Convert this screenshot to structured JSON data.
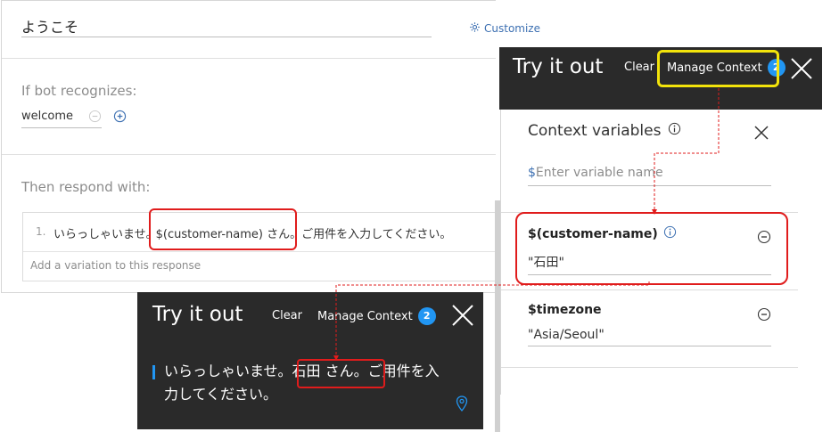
{
  "editor": {
    "node_title": "ようこそ",
    "customize_label": "Customize",
    "recognizes_label": "If bot recognizes:",
    "condition_value": "welcome",
    "respond_label": "Then respond with:",
    "response_number": "1.",
    "response_text_pre": "いらっしゃいませ。",
    "response_text_var": "$(customer-name) さん。",
    "response_text_post": "ご用件を入力してください。",
    "add_variation": "Add a variation to this response"
  },
  "try_it_out_right": {
    "title": "Try it out",
    "clear_label": "Clear",
    "manage_context_label": "Manage Context",
    "context_count": "2"
  },
  "context_panel": {
    "title": "Context variables",
    "new_var_prefix": "$",
    "new_var_placeholder": "Enter variable name",
    "variables": [
      {
        "name": "$(customer-name)",
        "value": "\"石田\""
      },
      {
        "name": "$timezone",
        "value": "\"Asia/Seoul\""
      }
    ]
  },
  "try_it_out_bottom": {
    "title": "Try it out",
    "clear_label": "Clear",
    "manage_context_label": "Manage Context",
    "context_count": "2",
    "bot_message": "いらっしゃいませ。石田 さん。ご用件を入力してください。"
  },
  "colors": {
    "highlight_red": "#e01c1c",
    "highlight_yellow": "#f2e30b",
    "accent_blue": "#2196f3",
    "link_blue": "#3d70b2",
    "panel_dark": "#2a2a2a"
  }
}
